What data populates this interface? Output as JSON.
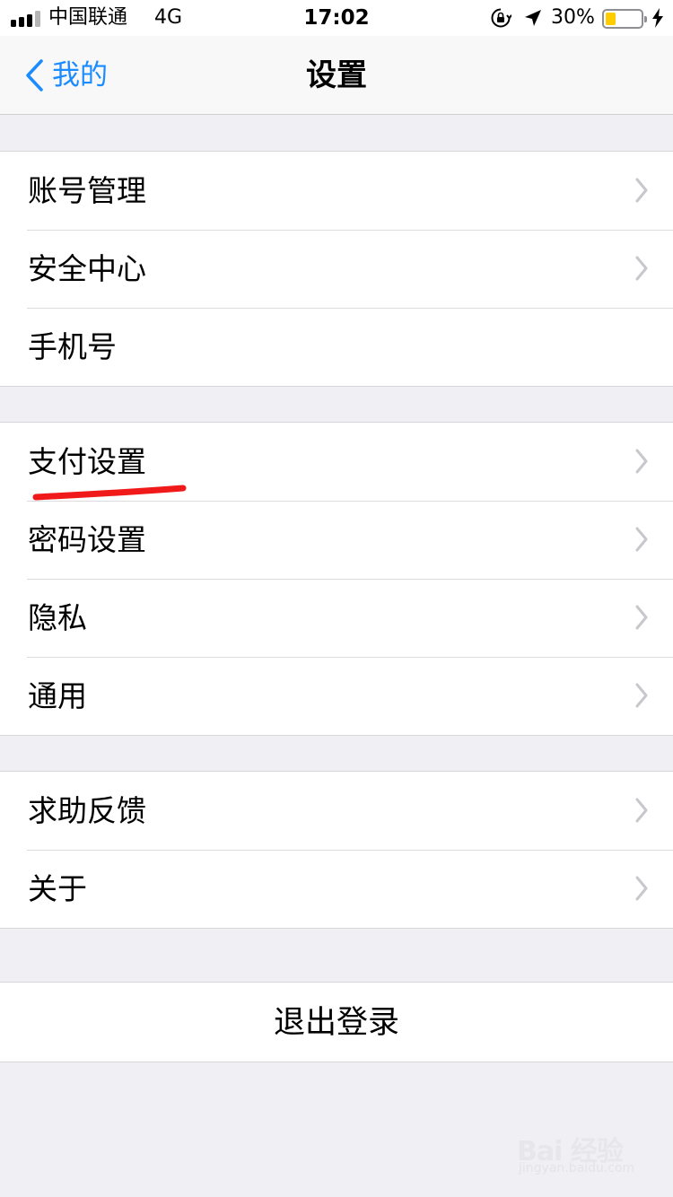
{
  "status_bar": {
    "carrier": "中国联通",
    "network": "4G",
    "time": "17:02",
    "battery_percent_text": "30%",
    "battery_level": 0.3,
    "battery_color": "#ffcc00",
    "icons": [
      "signal-icon",
      "rotation-lock-icon",
      "location-arrow-icon",
      "battery-icon",
      "charging-bolt-icon"
    ]
  },
  "nav": {
    "back_label": "我的",
    "title": "设置",
    "accent_color": "#1a8cff"
  },
  "groups": [
    {
      "items": [
        {
          "label": "账号管理",
          "chevron": true
        },
        {
          "label": "安全中心",
          "chevron": true
        },
        {
          "label": "手机号",
          "chevron": false
        }
      ]
    },
    {
      "items": [
        {
          "label": "支付设置",
          "chevron": true,
          "highlighted": true
        },
        {
          "label": "密码设置",
          "chevron": true
        },
        {
          "label": "隐私",
          "chevron": true
        },
        {
          "label": "通用",
          "chevron": true
        }
      ]
    },
    {
      "items": [
        {
          "label": "求助反馈",
          "chevron": true
        },
        {
          "label": "关于",
          "chevron": true
        }
      ]
    }
  ],
  "logout": {
    "label": "退出登录"
  },
  "watermark": {
    "brand": "Bai 经验",
    "url": "jingyan.baidu.com"
  }
}
